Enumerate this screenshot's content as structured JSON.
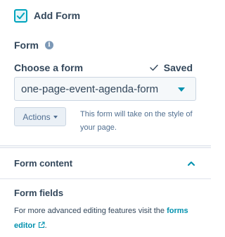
{
  "add_form": {
    "label": "Add Form",
    "checked": true
  },
  "form_section": {
    "heading": "Form"
  },
  "choose_form": {
    "label": "Choose a form",
    "saved_label": "Saved",
    "selected_value": "one-page-event-agenda-form"
  },
  "actions": {
    "button_label": "Actions"
  },
  "help_text": "This form will take on the style of your page.",
  "form_content": {
    "title": "Form content"
  },
  "form_fields": {
    "title": "Form fields",
    "description_prefix": "For more advanced editing features visit the",
    "link_text_1": "forms",
    "link_text_2": "editor",
    "description_suffix": "."
  },
  "colors": {
    "accent": "#00a4bd",
    "link": "#0091ae",
    "text": "#33475b"
  }
}
